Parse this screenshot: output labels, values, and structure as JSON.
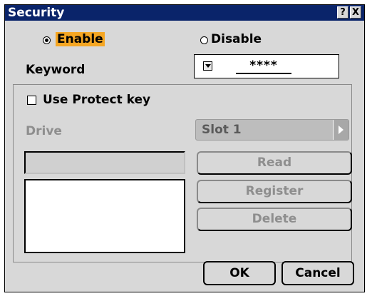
{
  "window": {
    "title": "Security",
    "help_icon": "?",
    "close_icon": "X"
  },
  "mode": {
    "enable_label": "Enable",
    "disable_label": "Disable",
    "selected": "Enable"
  },
  "keyword": {
    "label": "Keyword",
    "value": "****"
  },
  "protect": {
    "use_protect_key_label": "Use Protect key",
    "checked": false,
    "drive_label": "Drive",
    "drive_value": "Slot 1",
    "read_label": "Read",
    "register_label": "Register",
    "delete_label": "Delete"
  },
  "footer": {
    "ok_label": "OK",
    "cancel_label": "Cancel"
  },
  "colors": {
    "title_bar": "#0a246a",
    "dialog_bg": "#d8d8d8",
    "focus_highlight": "#f5a623"
  }
}
